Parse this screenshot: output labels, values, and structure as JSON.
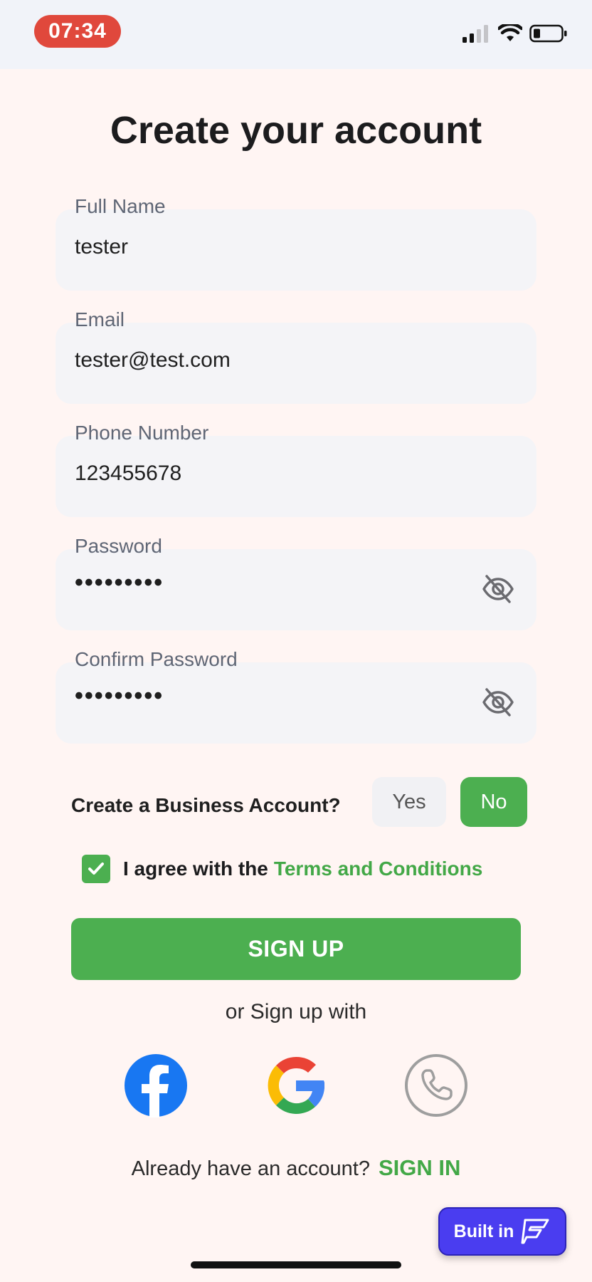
{
  "status_bar": {
    "time": "07:34",
    "icons": [
      "signal-icon",
      "wifi-icon",
      "battery-icon"
    ]
  },
  "title": "Create your account",
  "fields": {
    "full_name": {
      "label": "Full Name",
      "value": "tester"
    },
    "email": {
      "label": "Email",
      "value": "tester@test.com"
    },
    "phone": {
      "label": "Phone Number",
      "value": "123455678"
    },
    "password": {
      "label": "Password",
      "value": "•••••••••",
      "icon": "eye-off-icon"
    },
    "confirm_password": {
      "label": "Confirm Password",
      "value": "•••••••••",
      "icon": "eye-off-icon"
    }
  },
  "business": {
    "label": "Create a Business Account?",
    "yes_label": "Yes",
    "no_label": "No",
    "selected": "No"
  },
  "agree": {
    "checked": true,
    "text": "I agree with the",
    "link": "Terms and Conditions"
  },
  "signup_label": "SIGN UP",
  "or_text": "or Sign up with",
  "social": [
    "facebook-icon",
    "google-icon",
    "phone-icon"
  ],
  "signin": {
    "prompt": "Already have an account?",
    "link": "SIGN IN"
  },
  "badge": {
    "label": "Built in"
  },
  "colors": {
    "accent": "#4caf50",
    "link": "#43a847",
    "time_pill": "#e0483c",
    "badge": "#4a3df0"
  }
}
